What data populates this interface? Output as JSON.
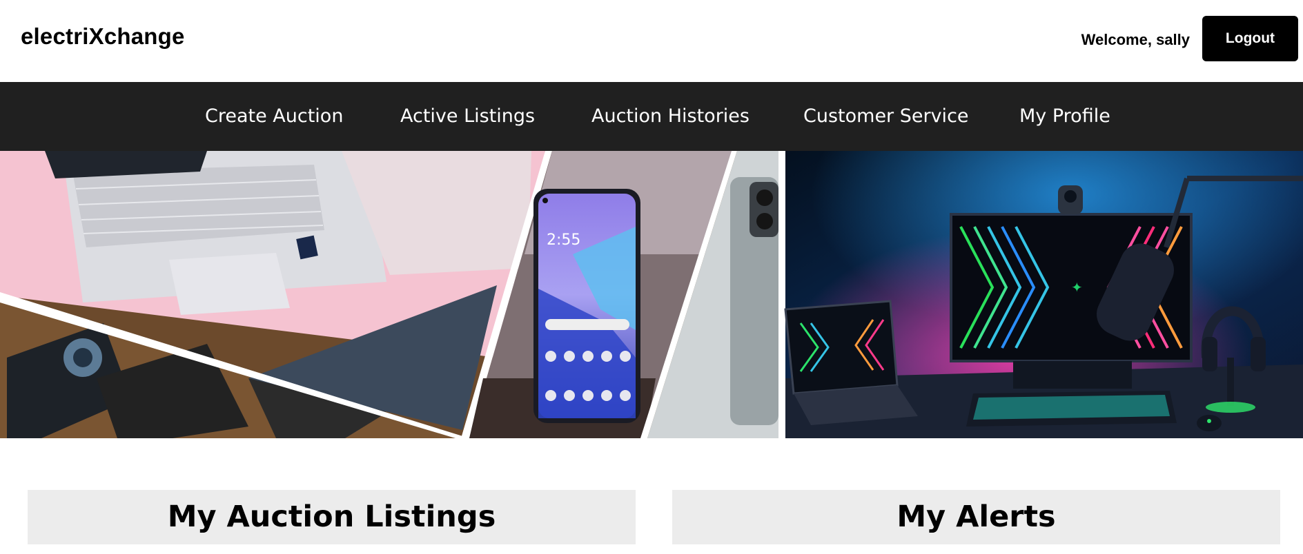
{
  "header": {
    "brand": "electriXchange",
    "welcome": "Welcome, sally",
    "logout_label": "Logout"
  },
  "nav": {
    "items": [
      {
        "label": "Create Auction"
      },
      {
        "label": "Active Listings"
      },
      {
        "label": "Auction Histories"
      },
      {
        "label": "Customer Service"
      },
      {
        "label": "My Profile"
      }
    ]
  },
  "hero": {
    "phone_time": "2:55"
  },
  "sections": {
    "listings_title": "My Auction Listings",
    "alerts_title": "My Alerts"
  },
  "colors": {
    "nav_bg": "#202020",
    "section_bg": "#ececec",
    "button_bg": "#000000"
  }
}
